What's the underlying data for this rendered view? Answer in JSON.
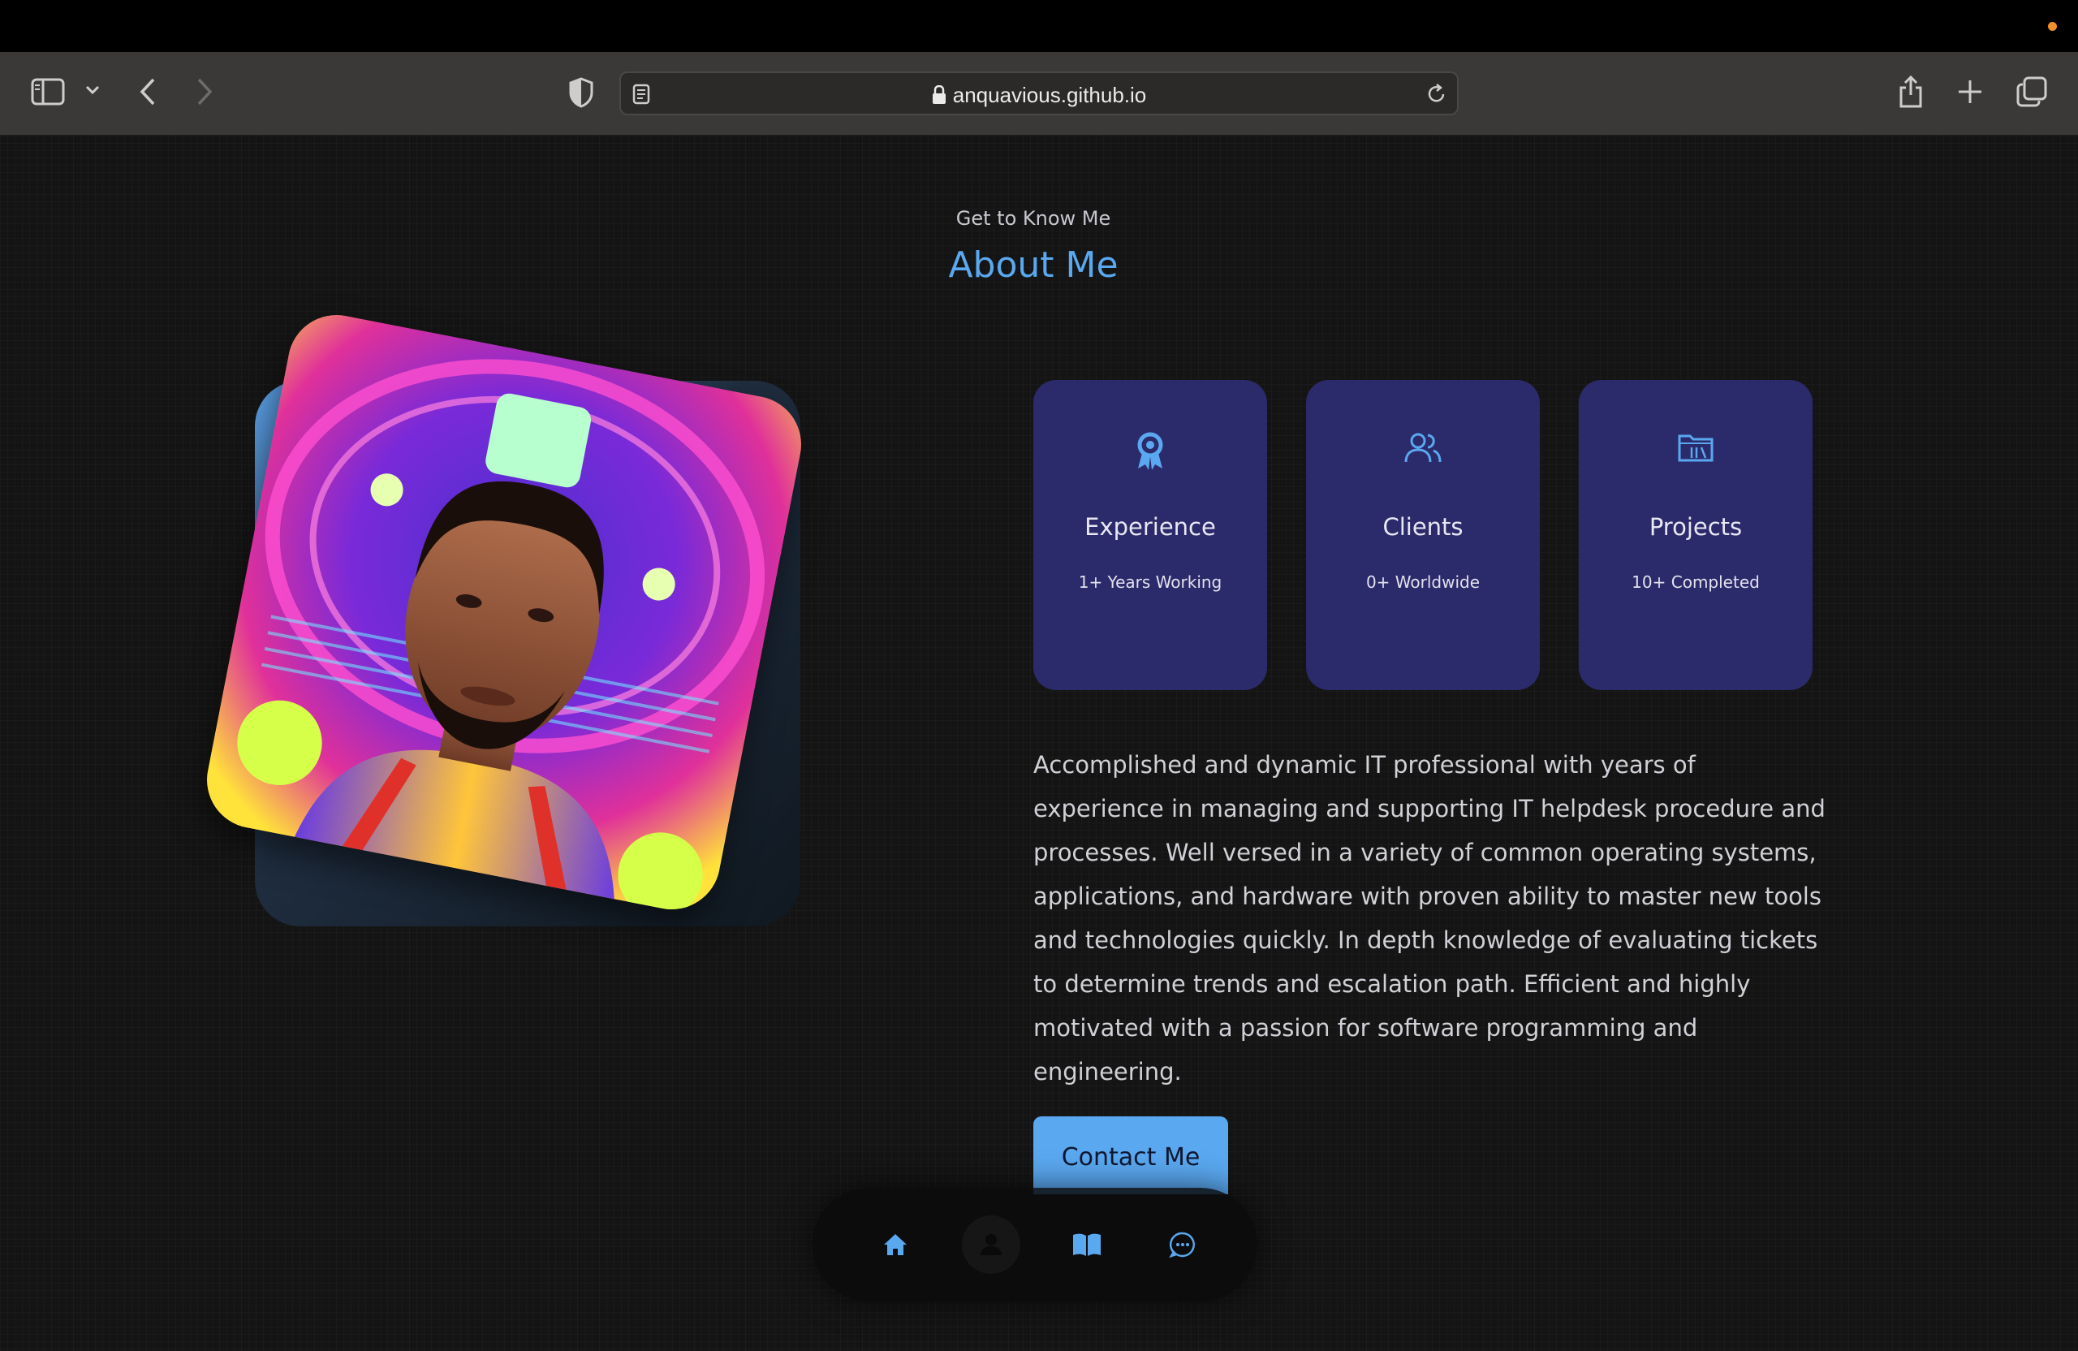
{
  "browser": {
    "url": "anquavious.github.io"
  },
  "about": {
    "subtitle": "Get to Know Me",
    "title": "About Me",
    "cards": [
      {
        "icon": "award-icon",
        "title": "Experience",
        "text": "1+ Years Working"
      },
      {
        "icon": "users-icon",
        "title": "Clients",
        "text": "0+ Worldwide"
      },
      {
        "icon": "folder-icon",
        "title": "Projects",
        "text": "10+ Completed"
      }
    ],
    "description": "Accomplished and dynamic IT professional with years of experience in managing and supporting IT helpdesk procedure and processes. Well versed in a variety of common operating systems, applications, and hardware with proven ability to master new tools and technologies quickly. In depth knowledge of evaluating tickets to determine trends and escalation path. Efficient and highly motivated with a passion for software programming and engineering.",
    "contact_label": "Contact Me"
  },
  "nav": {
    "items": [
      "home-icon",
      "user-icon",
      "book-icon",
      "chat-icon"
    ],
    "active": "user-icon"
  },
  "colors": {
    "accent": "#5aa8f0",
    "card": "#2b2a6a",
    "background": "#141414"
  }
}
